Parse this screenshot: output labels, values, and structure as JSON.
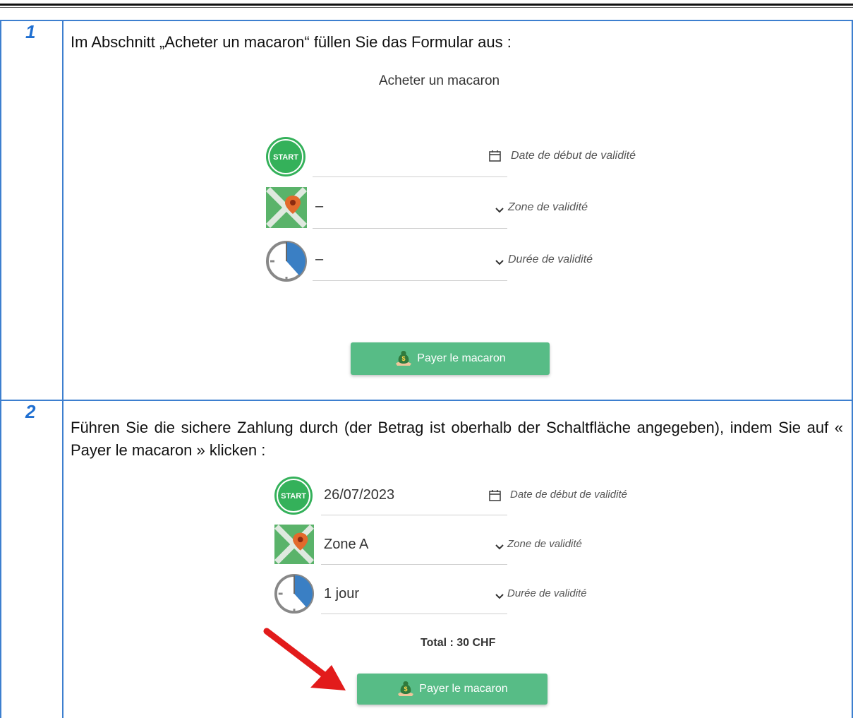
{
  "steps": [
    {
      "number": "1",
      "instruction": "Im Abschnitt „Acheter un macaron“ füllen Sie das Formular aus :",
      "form": {
        "title": "Acheter un macaron",
        "fields": [
          {
            "icon": "start-badge-icon",
            "value": "",
            "label": "Date de début de validité",
            "indicator": "calendar-icon"
          },
          {
            "icon": "map-pin-icon",
            "value": "–",
            "label": "Zone de validité",
            "indicator": "chevron-down-icon"
          },
          {
            "icon": "clock-icon",
            "value": "–",
            "label": "Durée de validité",
            "indicator": "chevron-down-icon"
          }
        ],
        "button_label": "Payer le macaron"
      }
    },
    {
      "number": "2",
      "instruction": "Führen Sie die sichere Zahlung durch (der Betrag ist oberhalb der Schaltfläche angegeben), indem Sie auf « Payer le macaron » klicken :",
      "form": {
        "fields": [
          {
            "icon": "start-badge-icon",
            "value": "26/07/2023",
            "label": "Date de début de validité",
            "indicator": "calendar-icon"
          },
          {
            "icon": "map-pin-icon",
            "value": "Zone A",
            "label": "Zone de validité",
            "indicator": "chevron-down-icon"
          },
          {
            "icon": "clock-icon",
            "value": "1 jour",
            "label": "Durée de validité",
            "indicator": "chevron-down-icon"
          }
        ],
        "total": "Total : 30 CHF",
        "button_label": "Payer le macaron"
      }
    }
  ],
  "start_badge_text": "START",
  "colors": {
    "table_border": "#3d7fcf",
    "step_number": "#1f6fd1",
    "start_green": "#34b15a",
    "map_green": "#5ab36a",
    "pin_orange": "#e26a2c",
    "clock_blue": "#3a7fc4",
    "button_green": "#57bc86",
    "arrow_red": "#e21b1b"
  }
}
